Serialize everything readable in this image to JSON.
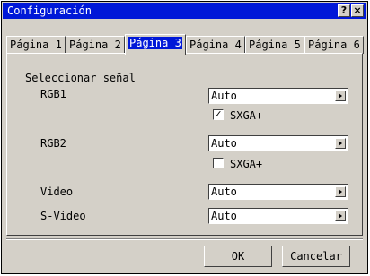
{
  "window": {
    "title": "Configuración",
    "help_label": "?",
    "close_label": "×"
  },
  "tabs": [
    {
      "label": "Página 1"
    },
    {
      "label": "Página 2"
    },
    {
      "label": "Página 3",
      "active": true
    },
    {
      "label": "Página 4"
    },
    {
      "label": "Página 5"
    },
    {
      "label": "Página 6"
    }
  ],
  "section": {
    "title": "Seleccionar señal"
  },
  "rows": {
    "rgb1": {
      "label": "RGB1",
      "value": "Auto",
      "check_label": "SXGA+",
      "checked": true,
      "check_mark": "✓"
    },
    "rgb2": {
      "label": "RGB2",
      "value": "Auto",
      "check_label": "SXGA+",
      "checked": false,
      "check_mark": ""
    },
    "video": {
      "label": "Video",
      "value": "Auto"
    },
    "svideo": {
      "label": "S-Video",
      "value": "Auto"
    }
  },
  "buttons": {
    "ok": "OK",
    "cancel": "Cancelar"
  },
  "colors": {
    "titlebar": "#0018d8",
    "face": "#d4d0c8"
  }
}
